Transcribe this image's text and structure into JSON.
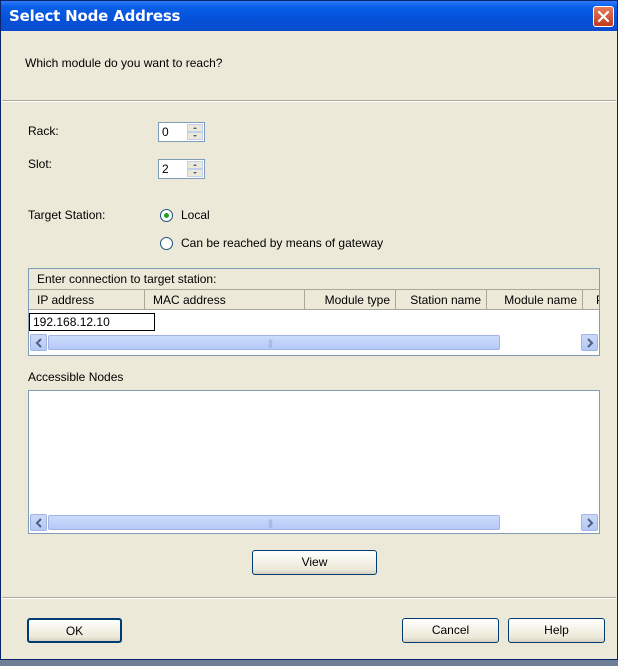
{
  "window": {
    "title": "Select Node Address"
  },
  "header": {
    "question": "Which module do you want to reach?"
  },
  "rack": {
    "label": "Rack:",
    "value": "0"
  },
  "slot": {
    "label": "Slot:",
    "value": "2"
  },
  "target_station": {
    "label": "Target Station:",
    "options": [
      {
        "label": "Local",
        "selected": true
      },
      {
        "label": "Can be reached by means of gateway",
        "selected": false
      }
    ]
  },
  "connection_table": {
    "caption": "Enter connection to target station:",
    "columns": [
      "IP address",
      "MAC address",
      "Module type",
      "Station name",
      "Module name",
      "P"
    ],
    "rows": [
      [
        "192.168.12.10",
        "",
        "",
        "",
        "",
        ""
      ]
    ]
  },
  "accessible_nodes": {
    "label": "Accessible Nodes"
  },
  "scroll": {
    "grip": "|||"
  },
  "buttons": {
    "view": "View",
    "ok": "OK",
    "cancel": "Cancel",
    "help": "Help"
  },
  "colors": {
    "titlebar": "#0451d8",
    "dialog_bg": "#ece9d8",
    "close_button": "#c0391a",
    "radio_dot": "#21a121"
  }
}
